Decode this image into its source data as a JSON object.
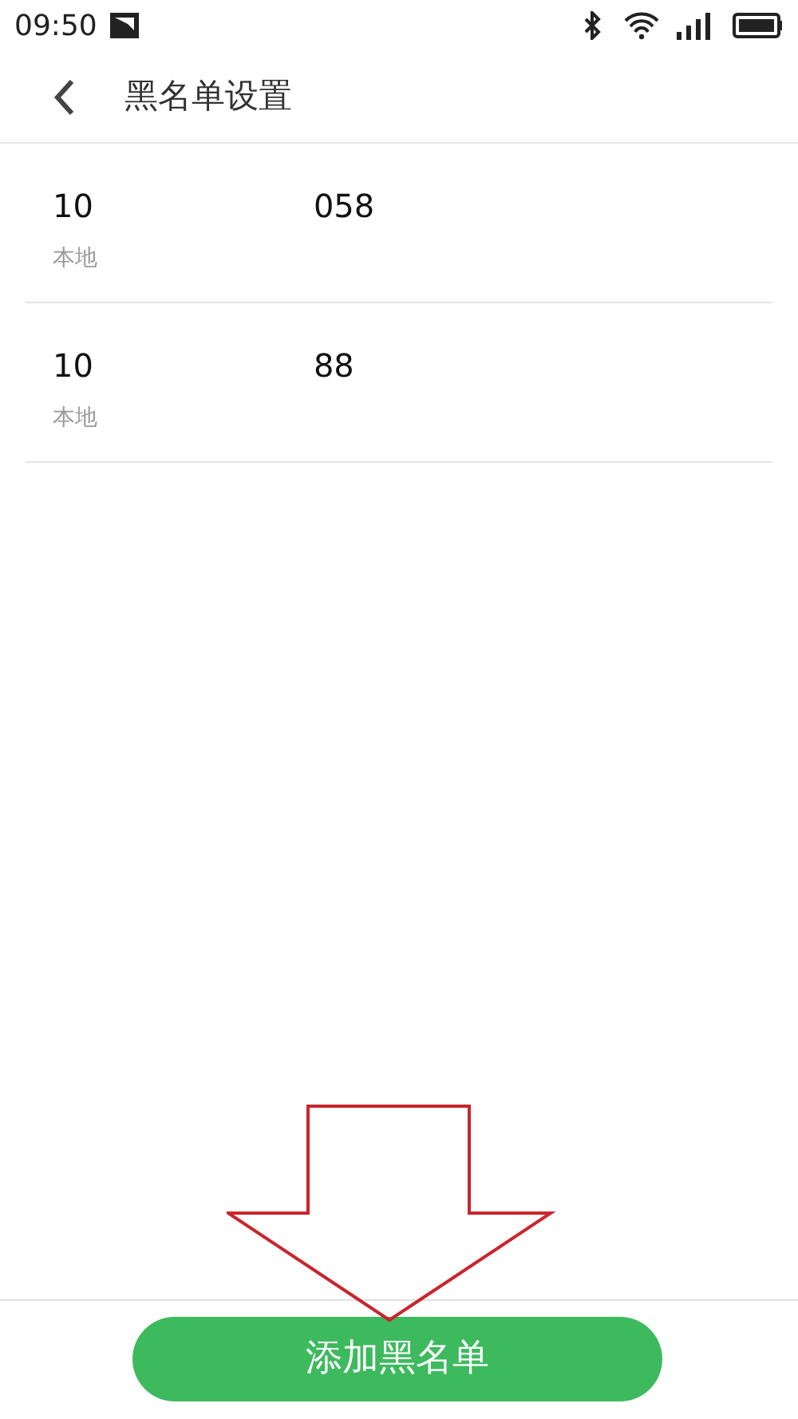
{
  "status_bar": {
    "time": "09:50"
  },
  "header": {
    "title": "黑名单设置"
  },
  "blacklist": [
    {
      "number_start": "10",
      "number_end": "058",
      "location": "本地"
    },
    {
      "number_start": "10",
      "number_end": "88",
      "location": "本地"
    }
  ],
  "add_button": {
    "label": "添加黑名单"
  }
}
